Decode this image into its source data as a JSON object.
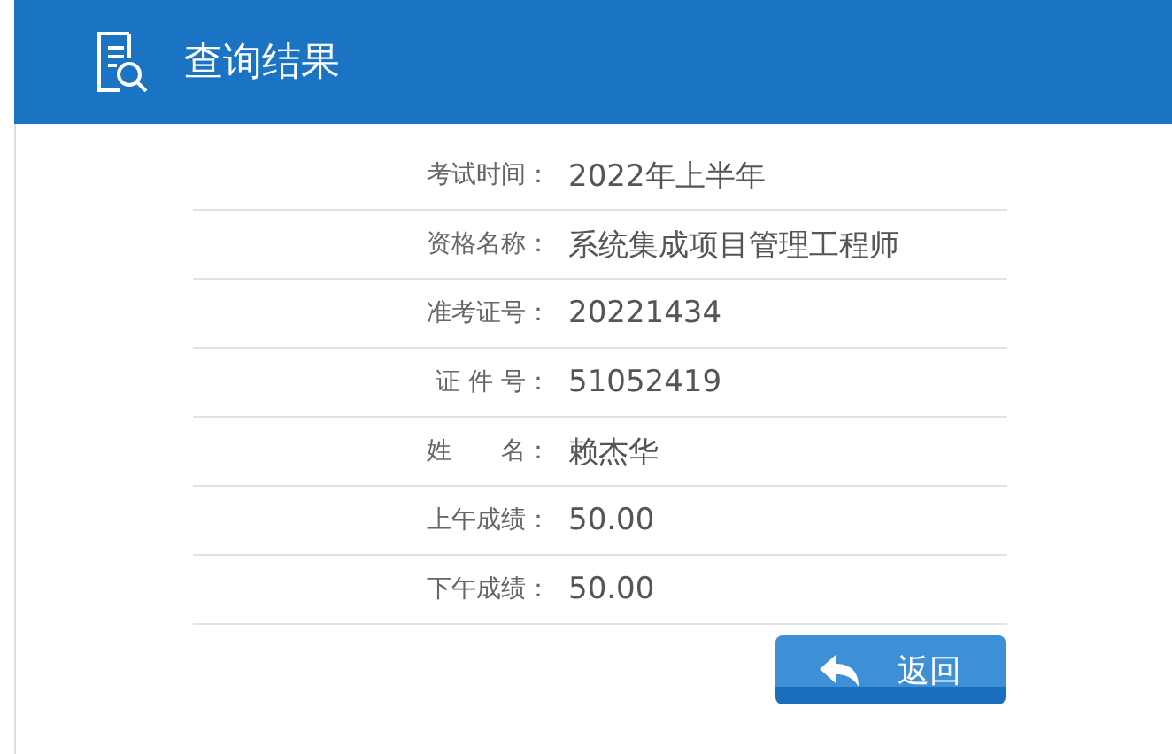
{
  "header": {
    "title": "查询结果"
  },
  "rows": [
    {
      "label": "考试时间：",
      "value": "2022年上半年"
    },
    {
      "label": "资格名称：",
      "value": "系统集成项目管理工程师"
    },
    {
      "label": "准考证号：",
      "value": "20221434"
    },
    {
      "label": "证 件 号：",
      "value": "51052419"
    },
    {
      "label": "姓　　名：",
      "value": "赖杰华"
    },
    {
      "label": "上午成绩：",
      "value": "50.00"
    },
    {
      "label": "下午成绩：",
      "value": "50.00"
    }
  ],
  "back_button": {
    "label": "返回"
  }
}
